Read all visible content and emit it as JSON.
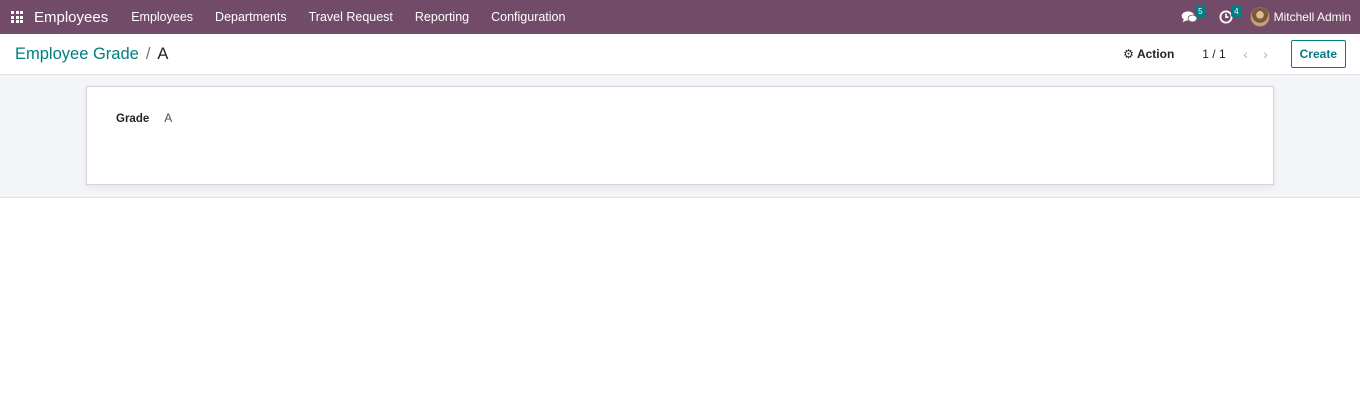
{
  "navbar": {
    "brand": "Employees",
    "menu": [
      "Employees",
      "Departments",
      "Travel Request",
      "Reporting",
      "Configuration"
    ],
    "messages_count": "5",
    "activities_count": "4",
    "user_name": "Mitchell Admin"
  },
  "control_panel": {
    "breadcrumb_parent": "Employee Grade",
    "breadcrumb_separator": "/",
    "breadcrumb_current": "A",
    "action_label": "Action",
    "pager_value": "1 / 1",
    "create_label": "Create"
  },
  "form": {
    "grade_label": "Grade",
    "grade_value": "A"
  },
  "colors": {
    "navbar": "#714B67",
    "accent": "#017e84",
    "background": "#f4f5f8"
  }
}
